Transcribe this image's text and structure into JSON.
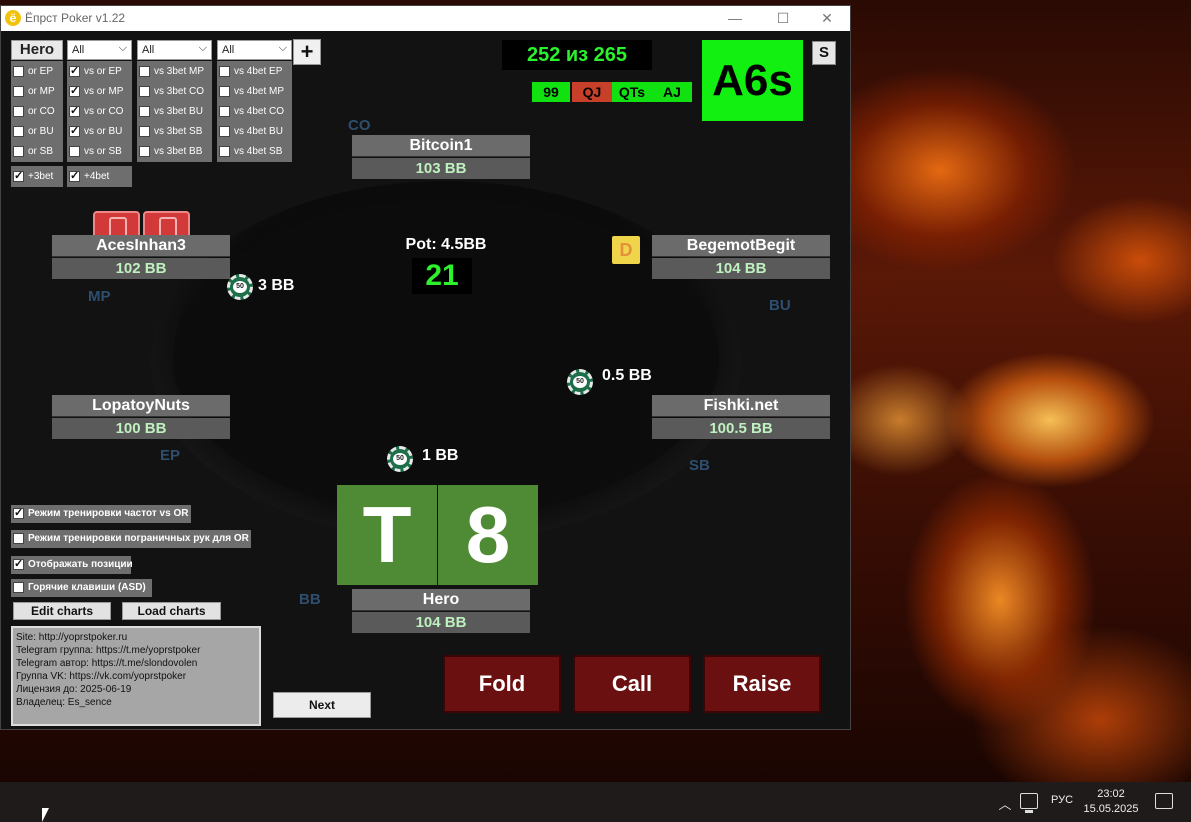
{
  "window": {
    "title": "Ёпрст Poker v1.22",
    "logo_letter": "ё",
    "min": "—",
    "max": "☐",
    "close": "✕"
  },
  "filters": {
    "hero_select": "Hero",
    "dropdowns": [
      {
        "value": "All"
      },
      {
        "value": "All"
      },
      {
        "value": "All"
      }
    ],
    "plus": "+"
  },
  "checkbox_groups": [
    {
      "items": [
        {
          "label": "or EP",
          "checked": false
        },
        {
          "label": "or MP",
          "checked": false
        },
        {
          "label": "or CO",
          "checked": false
        },
        {
          "label": "or BU",
          "checked": false
        },
        {
          "label": "or SB",
          "checked": false
        }
      ]
    },
    {
      "items": [
        {
          "label": "vs or EP",
          "checked": true
        },
        {
          "label": "vs or MP",
          "checked": true
        },
        {
          "label": "vs or CO",
          "checked": true
        },
        {
          "label": "vs or BU",
          "checked": true
        },
        {
          "label": "vs or SB",
          "checked": false
        }
      ]
    },
    {
      "items": [
        {
          "label": "vs 3bet MP",
          "checked": false
        },
        {
          "label": "vs 3bet CO",
          "checked": false
        },
        {
          "label": "vs 3bet BU",
          "checked": false
        },
        {
          "label": "vs 3bet SB",
          "checked": false
        },
        {
          "label": "vs 3bet BB",
          "checked": false
        }
      ]
    },
    {
      "items": [
        {
          "label": "vs 4bet EP",
          "checked": false
        },
        {
          "label": "vs 4bet MP",
          "checked": false
        },
        {
          "label": "vs 4bet CO",
          "checked": false
        },
        {
          "label": "vs 4bet BU",
          "checked": false
        },
        {
          "label": "vs 4bet SB",
          "checked": false
        }
      ]
    }
  ],
  "extra_checks": [
    {
      "label": "+3bet",
      "checked": true
    },
    {
      "label": "+4bet",
      "checked": true
    }
  ],
  "training_options": [
    {
      "label": "Режим тренировки частот vs OR",
      "checked": true
    },
    {
      "label": "Режим тренировки пограничных рук для OR",
      "checked": false
    },
    {
      "label": "Отображать позиции",
      "checked": true
    },
    {
      "label": "Горячие клавиши (ASD)",
      "checked": false
    }
  ],
  "chart_buttons": {
    "edit": "Edit charts",
    "load": "Load charts"
  },
  "info": [
    "Site: http://yoprstpoker.ru",
    "Telegram группа: https://t.me/yoprstpoker",
    "Telegram автор: https://t.me/slondovolen",
    "Группа VK: https://vk.com/yoprstpoker",
    "Лицензия до: 2025-06-19",
    "Владелец: Es_sence"
  ],
  "next_button": "Next",
  "stats": {
    "counter": "252 из 265",
    "mini_hands": [
      {
        "text": "99",
        "color": "#11e011"
      },
      {
        "text": "QJ",
        "color": "#c8402a"
      },
      {
        "text": "QTs",
        "color": "#11e011"
      },
      {
        "text": "AJ",
        "color": "#11e011"
      }
    ],
    "current_hand": "A6s",
    "s_button": "S"
  },
  "pot": {
    "label": "Pot: 4.5BB",
    "timer": "21"
  },
  "dealer": "D",
  "seats": {
    "co": {
      "name": "Bitcoin1",
      "stack": "103 BB",
      "pos": "CO"
    },
    "mp": {
      "name": "AcesInhan3",
      "stack": "102 BB",
      "pos": "MP",
      "bet": "3 BB"
    },
    "bu": {
      "name": "BegemotBegit",
      "stack": "104 BB",
      "pos": "BU"
    },
    "ep": {
      "name": "LopatoyNuts",
      "stack": "100 BB",
      "pos": "EP"
    },
    "sb": {
      "name": "Fishki.net",
      "stack": "100.5 BB",
      "pos": "SB",
      "bet": "0.5 BB"
    },
    "bb": {
      "name": "Hero",
      "stack": "104 BB",
      "pos": "BB",
      "bet": "1 BB"
    }
  },
  "hero_cards": [
    "T",
    "8"
  ],
  "actions": {
    "fold": "Fold",
    "call": "Call",
    "raise": "Raise"
  },
  "taskbar": {
    "chevron": "︿",
    "lang": "РУС",
    "time": "23:02",
    "date": "15.05.2025"
  },
  "colors": {
    "accent_green": "#2cf12c",
    "action_red": "#6b1010",
    "card_green": "#4f8a34"
  }
}
